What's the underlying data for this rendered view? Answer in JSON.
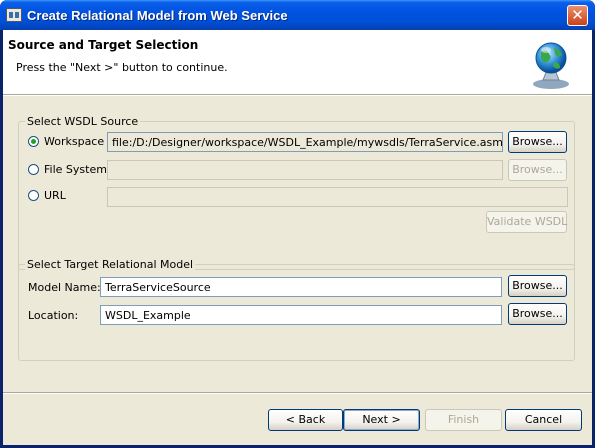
{
  "window": {
    "title": "Create Relational Model from Web Service"
  },
  "header": {
    "title": "Source and Target Selection",
    "message": "Press the \"Next >\" button to continue."
  },
  "wsdl_source": {
    "label": "Select WSDL Source",
    "options": [
      {
        "label": "Workspace",
        "checked": true,
        "value": "file:/D:/Designer/workspace/WSDL_Example/mywsdls/TerraService.asmx.wsdl",
        "browse_label": "Browse...",
        "browse_enabled": true
      },
      {
        "label": "File System",
        "checked": false,
        "value": "",
        "browse_label": "Browse...",
        "browse_enabled": false
      },
      {
        "label": "URL",
        "checked": false,
        "value": ""
      }
    ],
    "validate_label": "Validate WSDL"
  },
  "target_model": {
    "label": "Select Target Relational Model",
    "model_name_label": "Model Name:",
    "model_name_value": "TerraServiceSource",
    "location_label": "Location:",
    "location_value": "WSDL_Example",
    "browse_label": "Browse..."
  },
  "footer": {
    "back_label": "< Back",
    "next_label": "Next >",
    "finish_label": "Finish",
    "cancel_label": "Cancel"
  },
  "icons": {
    "app": "app-icon",
    "close": "close-icon",
    "wizard": "globe-web-service-icon"
  },
  "colors": {
    "titlebar": "#0053e1",
    "dialog_bg": "#ece9d8",
    "radio_dot": "#21a121",
    "close_button": "#c9431a"
  }
}
